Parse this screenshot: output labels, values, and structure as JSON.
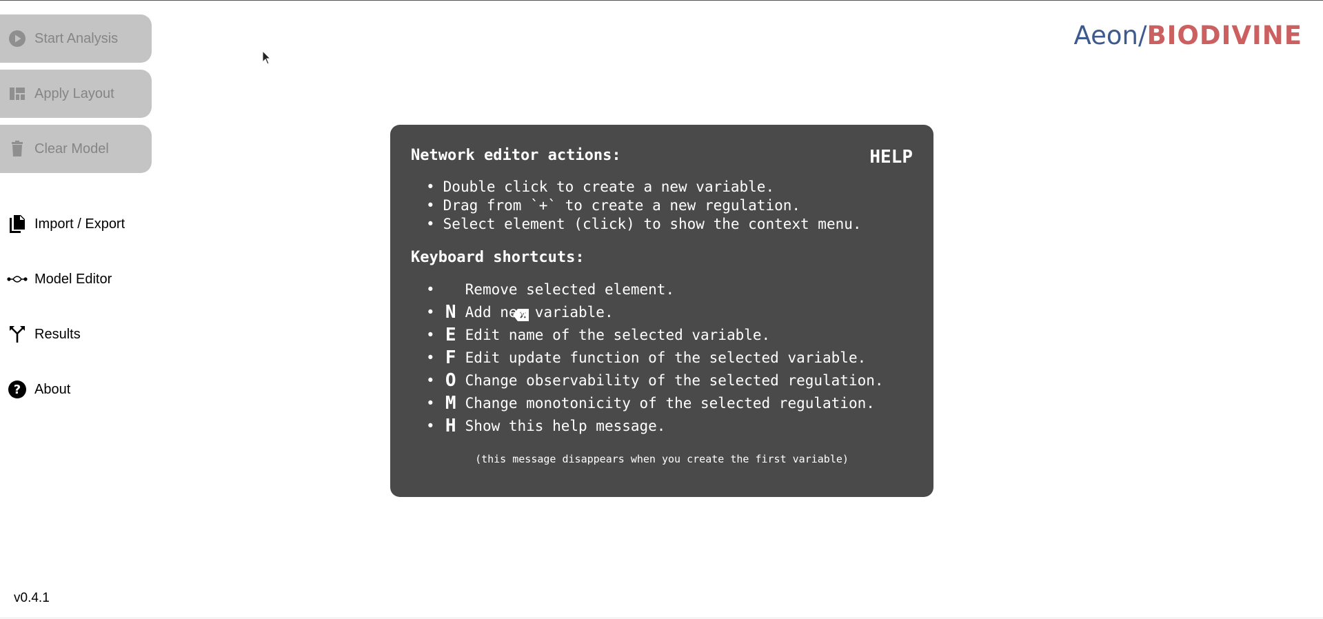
{
  "sidebar": {
    "actions": [
      {
        "label": "Start Analysis",
        "icon": "play-icon"
      },
      {
        "label": "Apply Layout",
        "icon": "layout-icon"
      },
      {
        "label": "Clear Model",
        "icon": "trash-icon"
      }
    ],
    "nav": [
      {
        "label": "Import / Export",
        "icon": "file-copy-icon"
      },
      {
        "label": "Model Editor",
        "icon": "network-icon"
      },
      {
        "label": "Results",
        "icon": "fork-icon"
      },
      {
        "label": "About",
        "icon": "help-circle-icon"
      }
    ],
    "version": "v0.4.1"
  },
  "logo": {
    "part1": "Aeon",
    "separator": "/",
    "part2": "BIODIVINE"
  },
  "help": {
    "title": "HELP",
    "actions_heading": "Network editor actions:",
    "actions": [
      "Double click to create a new variable.",
      "Drag from `+` to create a new regulation.",
      "Select element (click) to show the context menu."
    ],
    "shortcuts_heading": "Keyboard shortcuts:",
    "shortcuts": [
      {
        "key": "",
        "key_icon": "backspace-icon",
        "text": "Remove selected element."
      },
      {
        "key": "N",
        "text": "Add new variable."
      },
      {
        "key": "E",
        "text": "Edit name of the selected variable."
      },
      {
        "key": "F",
        "text": "Edit update function of the selected variable."
      },
      {
        "key": "O",
        "text": "Change observability of the selected regulation."
      },
      {
        "key": "M",
        "text": "Change monotonicity of the selected regulation."
      },
      {
        "key": "H",
        "text": "Show this help message."
      }
    ],
    "footnote": "(this message disappears when you create the first variable)"
  },
  "colors": {
    "action_button_bg": "#c4c4c4",
    "action_button_text": "#858585",
    "help_bg": "#4a4a4a",
    "logo_blue": "#3d5a8e",
    "logo_red": "#cc5f5f"
  }
}
